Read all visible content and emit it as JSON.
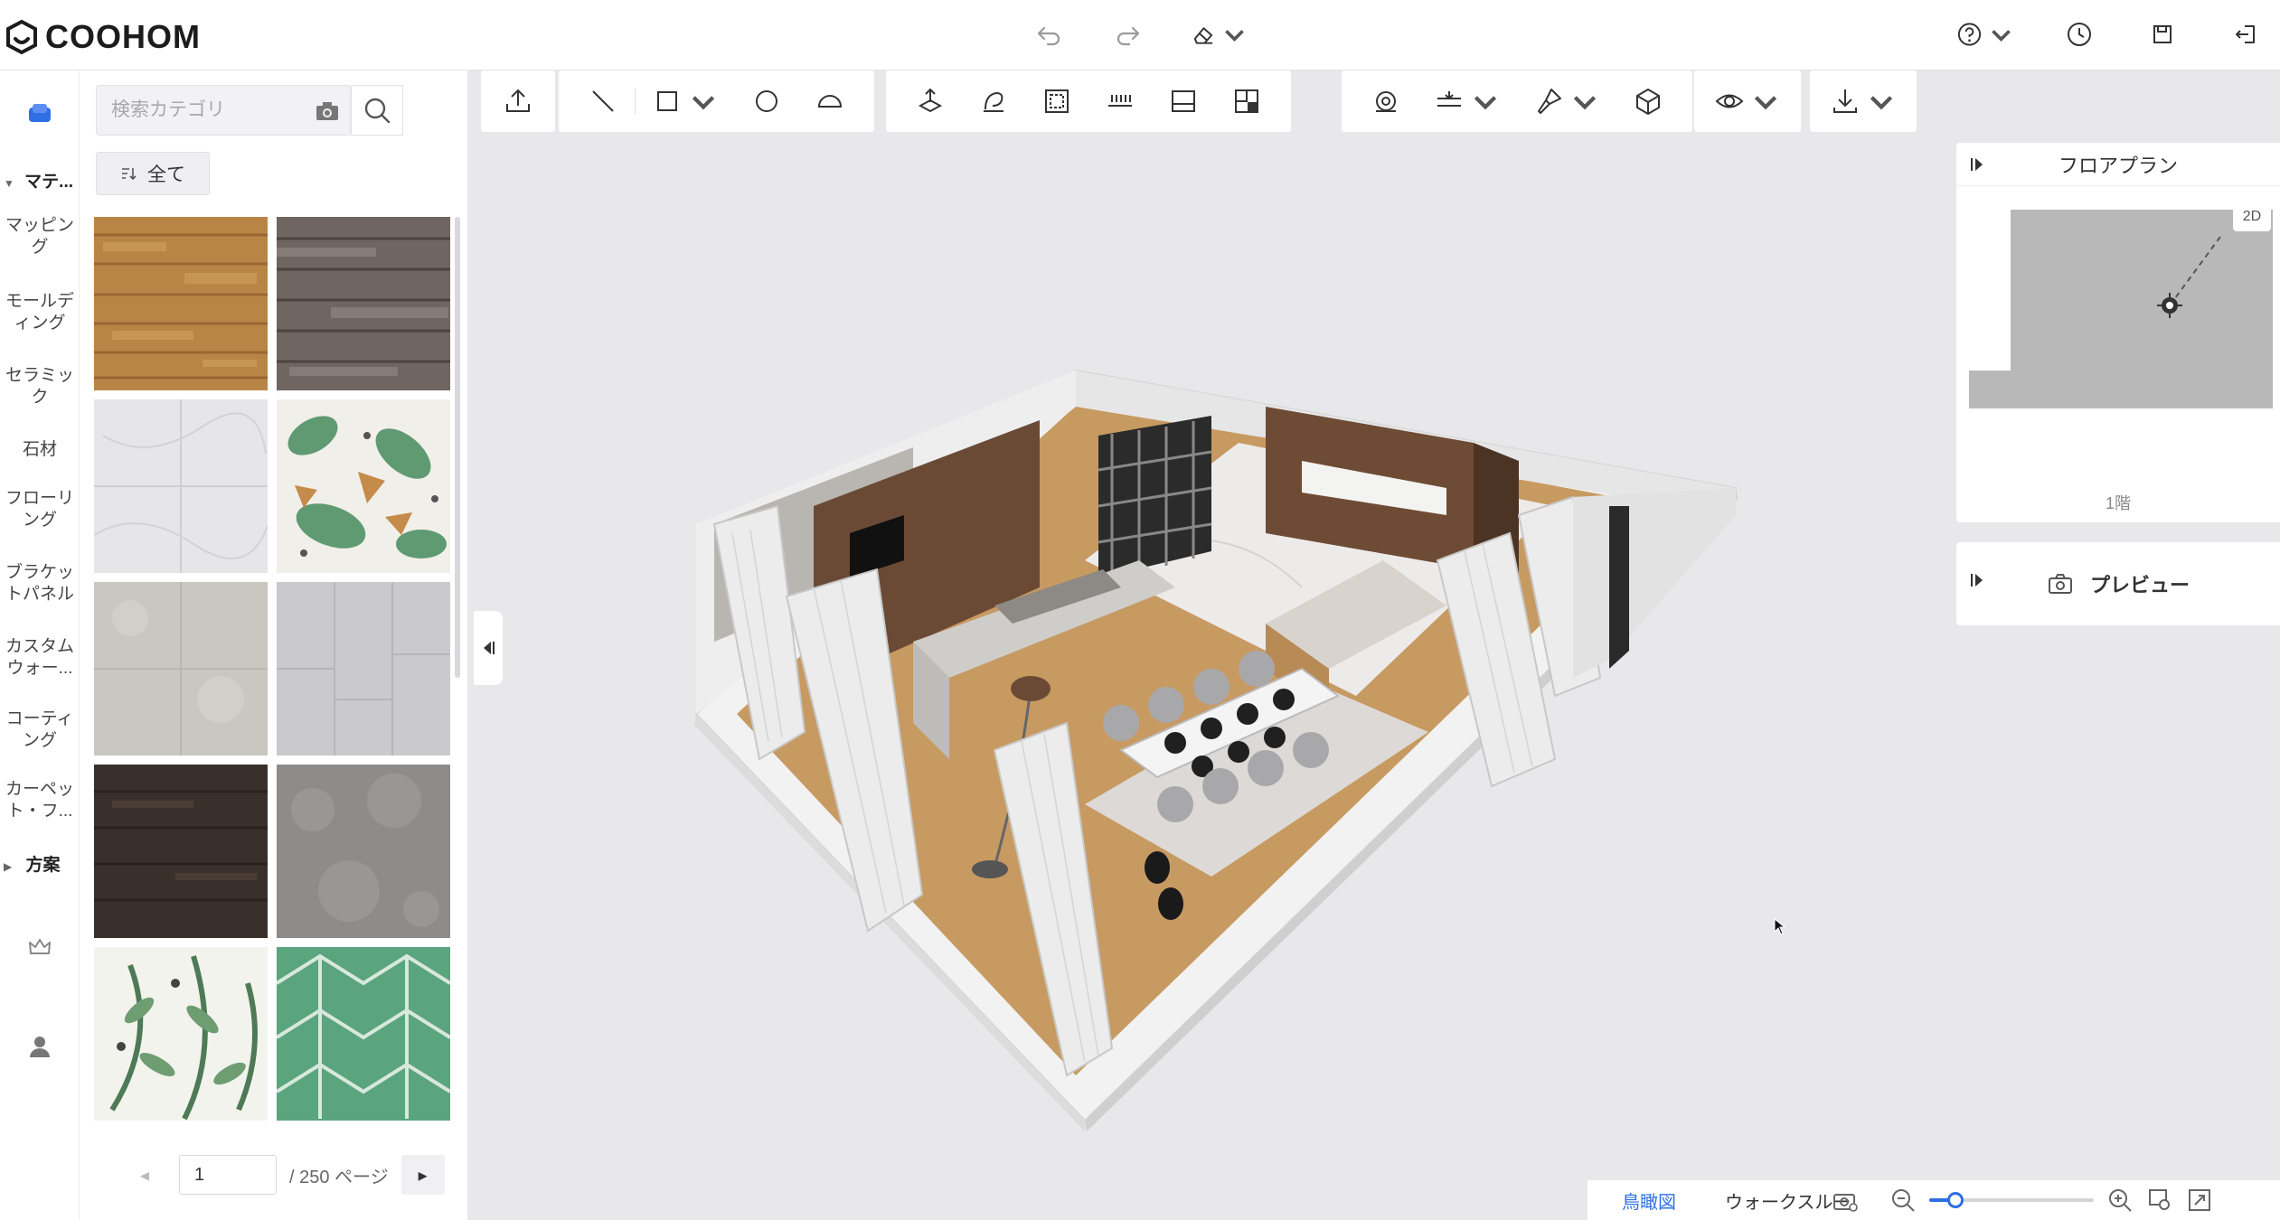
{
  "app": {
    "logo_text": "COOHOM"
  },
  "sidebar_rail": {
    "section_material": "マテ...",
    "items": [
      "マッピング",
      "モールディング",
      "セラミック",
      "石材",
      "フローリング",
      "ブラケットパネル",
      "カスタムウォー...",
      "コーティング",
      "カーペット・フ..."
    ],
    "section_plan": "方案"
  },
  "library": {
    "search_placeholder": "検索カテゴリ",
    "filter_label": "全て",
    "tiles": [
      "wood-warm",
      "wood-grey",
      "marble-white",
      "tropical-leaves",
      "stone-beige",
      "grey-tiles",
      "dark-wood",
      "grey-stone",
      "palm-leaves",
      "green-geometric"
    ],
    "pager": {
      "page": "1",
      "total": "/ 250 ページ"
    }
  },
  "floorplan": {
    "title": "フロアプラン",
    "view_badge": "2D",
    "floor_label": "1階"
  },
  "preview": {
    "label": "プレビュー"
  },
  "view_modes": {
    "aerial": "鳥瞰図",
    "walkthrough": "ウォークスルー"
  },
  "zoom": {
    "level": 0.16
  },
  "colors": {
    "accent": "#2f6fe4",
    "canvas_bg": "#e8e8ea"
  }
}
